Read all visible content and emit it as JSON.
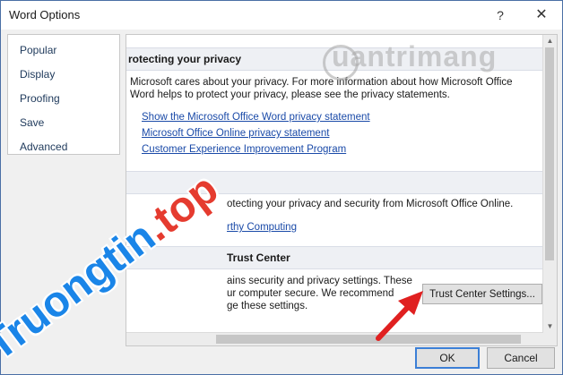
{
  "window": {
    "title": "Word Options",
    "help_glyph": "?",
    "close_glyph": "✕"
  },
  "nav": {
    "items": [
      {
        "label": "Popular"
      },
      {
        "label": "Display"
      },
      {
        "label": "Proofing"
      },
      {
        "label": "Save"
      },
      {
        "label": "Advanced"
      }
    ]
  },
  "sections": {
    "privacy": {
      "header": "rotecting your privacy",
      "line1": "Microsoft cares about your privacy. For more information about how Microsoft Office",
      "line2": "Word helps to protect your privacy, please see the privacy statements.",
      "links": [
        "Show the Microsoft Office Word privacy statement",
        "Microsoft Office Online privacy statement",
        "Customer Experience Improvement Program"
      ]
    },
    "security": {
      "line1": "otecting your privacy and security from Microsoft Office Online.",
      "link": "rthy Computing"
    },
    "trust": {
      "header": "Trust Center",
      "line1": "ains security and privacy settings. These",
      "line2": "ur computer secure. We recommend",
      "line3": "ge these settings.",
      "button": "Trust Center Settings..."
    }
  },
  "footer": {
    "ok": "OK",
    "cancel": "Cancel"
  },
  "watermarks": {
    "quantrimang": "uantrimang",
    "truongtin_main": "Truongtin",
    "truongtin_tld": ".top"
  },
  "colors": {
    "link": "#1a4aa8",
    "arrow": "#e02020",
    "watermark_blue": "#1a85e8",
    "watermark_red": "#e53b2f"
  }
}
